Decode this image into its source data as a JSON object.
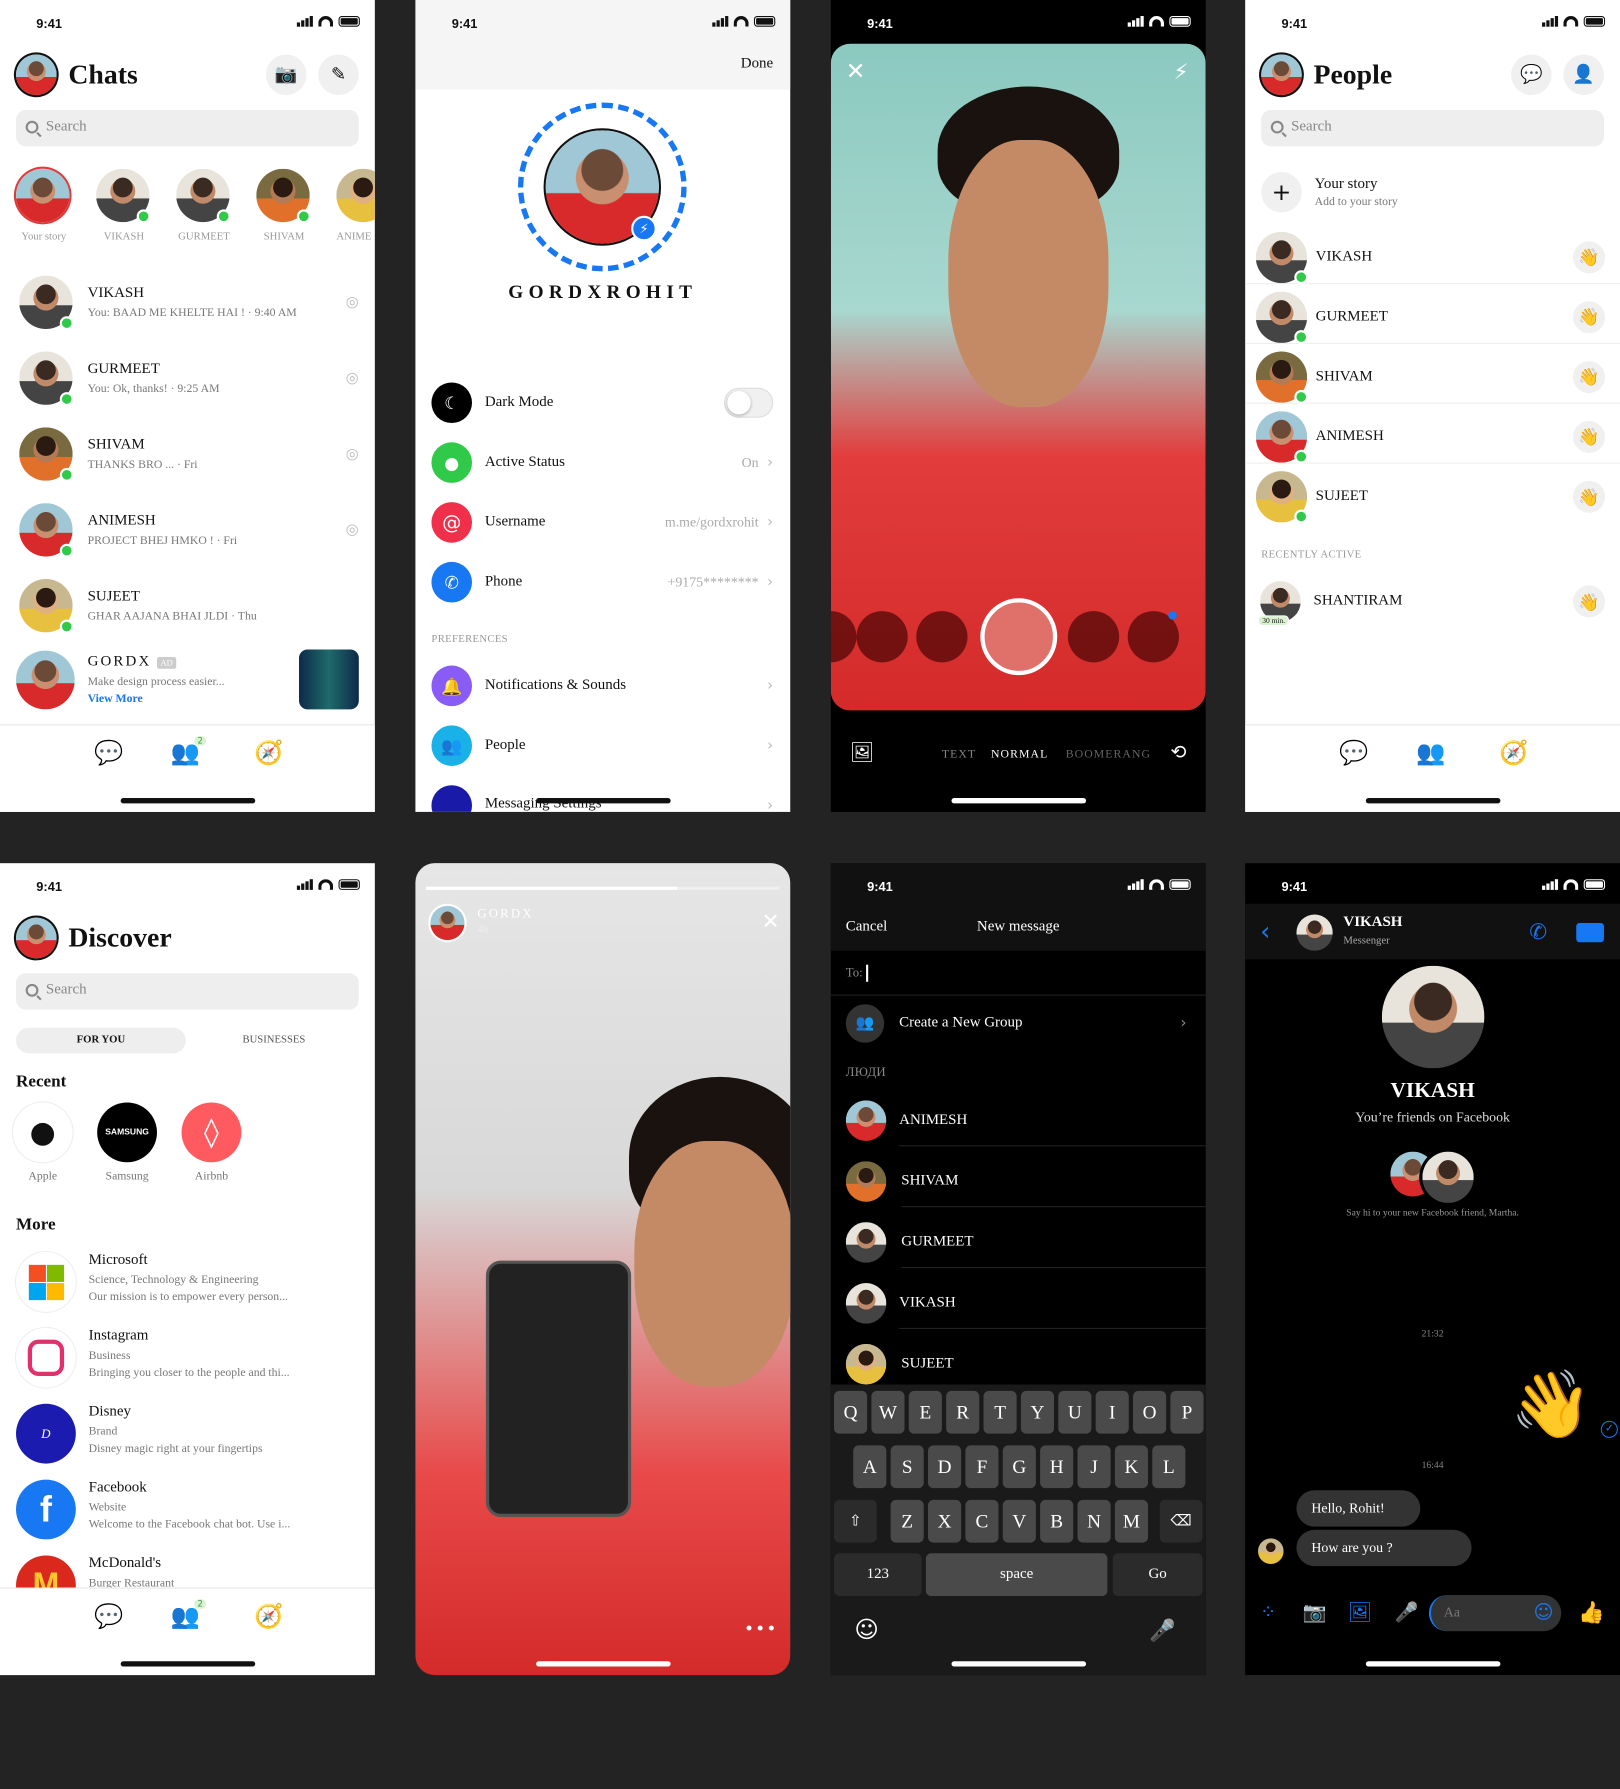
{
  "status": {
    "time": "9:41"
  },
  "colors": {
    "messenger_blue": "#1877f2",
    "online_green": "#31c94a",
    "dark_bg": "#000000"
  },
  "chats": {
    "title": "Chats",
    "search_placeholder": "Search",
    "stories": [
      "Your story",
      "VIKASH",
      "GURMEET",
      "SHIVAM",
      "ANIME"
    ],
    "list": [
      {
        "name": "VIKASH",
        "preview": "You: BAAD ME KHELTE HAI ! · 9:40 AM"
      },
      {
        "name": "GURMEET",
        "preview": "You: Ok, thanks! · 9:25 AM"
      },
      {
        "name": "SHIVAM",
        "preview": "THANKS BRO ... · Fri"
      },
      {
        "name": "ANIMESH",
        "preview": "PROJECT BHEJ HMKO ! · Fri"
      },
      {
        "name": "SUJEET",
        "preview": "GHAR AAJANA BHAI JLDI · Thu"
      }
    ],
    "ad": {
      "name": "GORDX",
      "badge": "AD",
      "text": "Make design process easier...",
      "link": "View More"
    },
    "people_badge": "2"
  },
  "settings": {
    "done": "Done",
    "handle": "GORDXROHIT",
    "rows": [
      {
        "label": "Dark Mode",
        "value": ""
      },
      {
        "label": "Active Status",
        "value": "On"
      },
      {
        "label": "Username",
        "value": "m.me/gordxrohit"
      },
      {
        "label": "Phone",
        "value": "+9175********"
      }
    ],
    "preferences": "PREFERENCES",
    "pref_rows": [
      "Notifications & Sounds",
      "People",
      "Messaging Settings"
    ]
  },
  "camera": {
    "modes": [
      "TEXT",
      "NORMAL",
      "BOOMERANG"
    ]
  },
  "people": {
    "title": "People",
    "search_placeholder": "Search",
    "your_story": "Your story",
    "add_story": "Add to your story",
    "list": [
      "VIKASH",
      "GURMEET",
      "SHIVAM",
      "ANIMESH",
      "SUJEET"
    ],
    "recently_active": "RECENTLY ACTIVE",
    "recent": {
      "name": "SHANTIRAM",
      "badge": "30 min."
    }
  },
  "discover": {
    "title": "Discover",
    "search_placeholder": "Search",
    "tabs": [
      "FOR YOU",
      "BUSINESSES"
    ],
    "recent_heading": "Recent",
    "recent": [
      "Apple",
      "Samsung",
      "Airbnb"
    ],
    "samsung_logo": "SAMSUNG",
    "more_heading": "More",
    "more": [
      {
        "name": "Microsoft",
        "category": "Science, Technology & Engineering",
        "desc": "Our mission is to empower every person..."
      },
      {
        "name": "Instagram",
        "category": "Business",
        "desc": "Bringing you closer to the people and thi..."
      },
      {
        "name": "Disney",
        "category": "Brand",
        "desc": "Disney magic right at your fingertips"
      },
      {
        "name": "Facebook",
        "category": "Website",
        "desc": "Welcome to the Facebook chat bot. Use i..."
      },
      {
        "name": "McDonald's",
        "category": "Burger Restaurant",
        "desc": ""
      }
    ],
    "people_badge": "2"
  },
  "story": {
    "name": "GORDX",
    "time": "4h",
    "more": "•••"
  },
  "new_message": {
    "cancel": "Cancel",
    "title": "New message",
    "to": "To:",
    "create_group": "Create a New Group",
    "section": "ЛЮДИ",
    "people": [
      "ANIMESH",
      "SHIVAM",
      "GURMEET",
      "VIKASH",
      "SUJEET"
    ],
    "keys_row1": [
      "Q",
      "W",
      "E",
      "R",
      "T",
      "Y",
      "U",
      "I",
      "O",
      "P"
    ],
    "keys_row2": [
      "A",
      "S",
      "D",
      "F",
      "G",
      "H",
      "J",
      "K",
      "L"
    ],
    "keys_row3": [
      "Z",
      "X",
      "C",
      "V",
      "B",
      "N",
      "M"
    ],
    "num_key": "123",
    "space": "space",
    "go": "Go"
  },
  "conversation": {
    "name": "VIKASH",
    "sub": "Messenger",
    "friends": "You’re friends on Facebook",
    "say_hi": "Say hi to your new Facebook friend, Martha.",
    "time1": "21:32",
    "time2": "16:44",
    "messages": [
      "Hello, Rohit!",
      "How are you ?"
    ],
    "input_placeholder": "Aa"
  }
}
